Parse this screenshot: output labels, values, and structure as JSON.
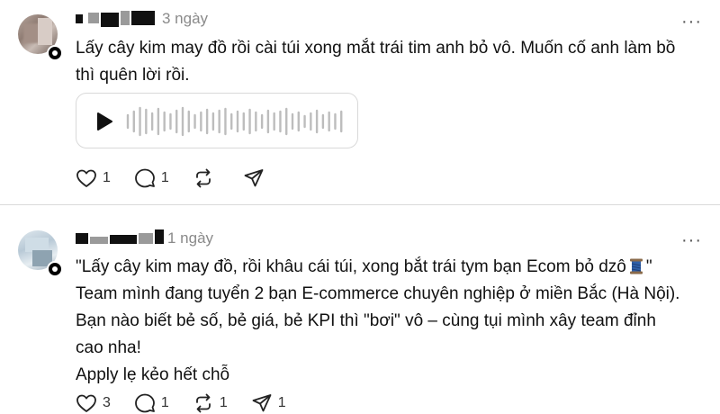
{
  "posts": [
    {
      "time": "3 ngày",
      "more": "···",
      "text_lines": [
        "Lấy cây kim may đồ rồi cài túi xong mắt trái tim anh bỏ vô. Muốn cố anh làm bồ",
        "thì quên lời rồi."
      ],
      "audio": {
        "icon": "play-icon"
      },
      "likes": "1",
      "replies": "1",
      "reposts": "",
      "shares": ""
    },
    {
      "time": "1 ngày",
      "more": "···",
      "text_line1": "\"Lấy cây kim may đồ, rồi khâu cái túi, xong bắt trái tym bạn Ecom bỏ dzô",
      "text_line1_end": "\"",
      "text_lines_rest": [
        "Team mình đang tuyển 2 bạn E-commerce chuyên nghiệp ở miền Bắc (Hà Nội).",
        "Bạn nào biết bẻ số, bẻ giá, bẻ KPI thì \"bơi\" vô – cùng tụi mình xây team đỉnh",
        "cao nha!",
        "Apply lẹ kẻo hết chỗ"
      ],
      "likes": "3",
      "replies": "1",
      "reposts": "1",
      "shares": "1"
    }
  ],
  "icons": {
    "like": "heart-icon",
    "reply": "comment-icon",
    "repost": "repost-icon",
    "share": "send-icon",
    "emoji": "thread-spool-emoji"
  }
}
